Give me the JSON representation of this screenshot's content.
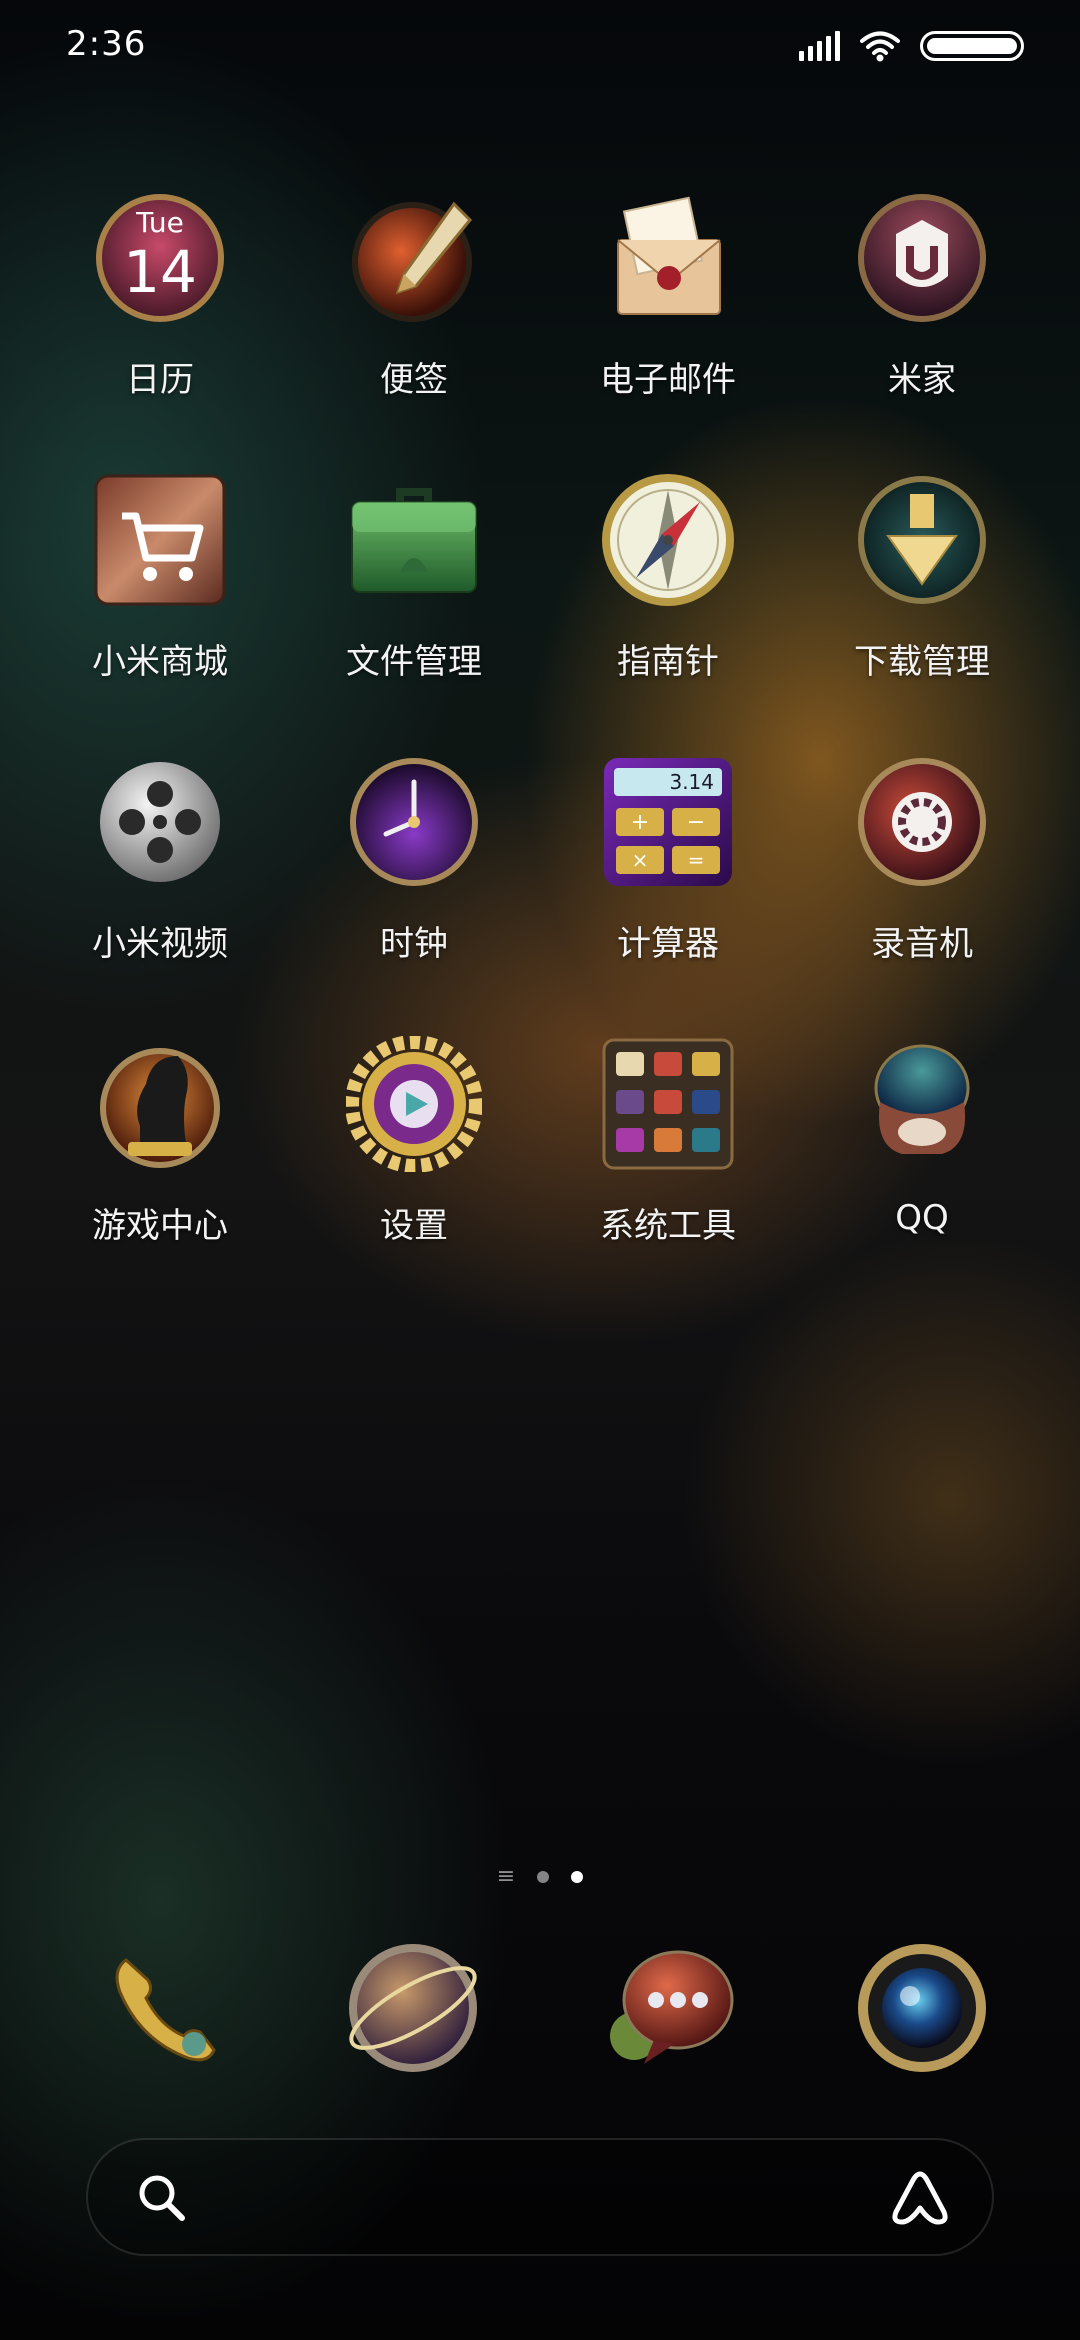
{
  "status_bar": {
    "time": "2:36",
    "icons": [
      "signal-icon",
      "wifi-icon",
      "battery-icon"
    ]
  },
  "apps": [
    {
      "id": "calendar",
      "label": "日历",
      "icon": "calendar-icon",
      "day": "Tue",
      "date": "14"
    },
    {
      "id": "notes",
      "label": "便签",
      "icon": "fountain-pen-icon"
    },
    {
      "id": "email",
      "label": "电子邮件",
      "icon": "envelope-icon"
    },
    {
      "id": "mijia",
      "label": "米家",
      "icon": "mijia-icon"
    },
    {
      "id": "mi-store",
      "label": "小米商城",
      "icon": "shopping-cart-icon"
    },
    {
      "id": "file-manager",
      "label": "文件管理",
      "icon": "briefcase-icon"
    },
    {
      "id": "compass",
      "label": "指南针",
      "icon": "compass-icon"
    },
    {
      "id": "downloads",
      "label": "下载管理",
      "icon": "download-icon"
    },
    {
      "id": "mi-video",
      "label": "小米视频",
      "icon": "film-reel-icon"
    },
    {
      "id": "clock",
      "label": "时钟",
      "icon": "clock-icon"
    },
    {
      "id": "calculator",
      "label": "计算器",
      "icon": "calculator-icon",
      "display": "3.14"
    },
    {
      "id": "recorder",
      "label": "录音机",
      "icon": "recorder-icon"
    },
    {
      "id": "game-center",
      "label": "游戏中心",
      "icon": "chess-knight-icon"
    },
    {
      "id": "settings",
      "label": "设置",
      "icon": "gear-icon"
    },
    {
      "id": "system-tools",
      "label": "系统工具",
      "icon": "folder-icon"
    },
    {
      "id": "qq",
      "label": "QQ",
      "icon": "qq-penguin-icon"
    }
  ],
  "page_indicator": {
    "pages": 3,
    "active": 2
  },
  "dock": [
    {
      "id": "phone",
      "icon": "phone-icon"
    },
    {
      "id": "browser",
      "icon": "globe-icon"
    },
    {
      "id": "messages",
      "icon": "message-bubble-icon"
    },
    {
      "id": "camera",
      "icon": "camera-lens-icon"
    }
  ],
  "search_bar": {
    "left_icon": "search-icon",
    "right_icon": "assistant-icon"
  },
  "colors": {
    "accent_gold": "#d6a94a",
    "label": "#f3f3f3"
  }
}
